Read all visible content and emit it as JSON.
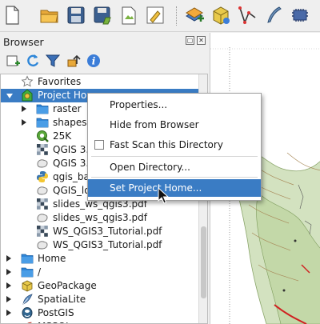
{
  "toolbar": {
    "icons": [
      "new-project-icon",
      "open-project-icon",
      "save-project-icon",
      "save-as-icon",
      "print-layout-icon",
      "style-manager-icon",
      "add-layer-icon",
      "new-geopackage-icon",
      "digitize-icon",
      "pen-icon",
      "processing-icon"
    ]
  },
  "browser": {
    "title": "Browser",
    "float_glyph": "▢",
    "close_glyph": "✕",
    "tools": [
      "add-selected-layers-icon",
      "refresh-icon",
      "filter-icon",
      "collapse-all-icon",
      "info-icon"
    ],
    "items": [
      {
        "label": "Favorites",
        "icon": "star-icon",
        "level": 0,
        "expander": "none"
      },
      {
        "label": "Project Home",
        "icon": "project-home-icon",
        "level": 0,
        "expander": "down",
        "selected": true
      },
      {
        "label": "raster",
        "icon": "folder-icon",
        "level": 1,
        "expander": "right"
      },
      {
        "label": "shapes",
        "icon": "folder-icon",
        "level": 1,
        "expander": "right"
      },
      {
        "label": "25K",
        "icon": "qgis-project-icon",
        "level": 1,
        "expander": "none"
      },
      {
        "label": "QGIS 3.",
        "icon": "raster-file-icon",
        "level": 1,
        "expander": "none"
      },
      {
        "label": "QGIS 3.",
        "icon": "vector-file-icon",
        "level": 1,
        "expander": "none"
      },
      {
        "label": "qgis_ba",
        "icon": "python-file-icon",
        "level": 1,
        "expander": "none"
      },
      {
        "label": "QGIS_lo",
        "icon": "vector-file-icon",
        "level": 1,
        "expander": "none"
      },
      {
        "label": "slides_ws_qgis3.pdf",
        "icon": "raster-file-icon",
        "level": 1,
        "expander": "none"
      },
      {
        "label": "slides_ws_qgis3.pdf",
        "icon": "vector-file-icon",
        "level": 1,
        "expander": "none"
      },
      {
        "label": "WS_QGIS3_Tutorial.pdf",
        "icon": "raster-file-icon",
        "level": 1,
        "expander": "none"
      },
      {
        "label": "WS_QGIS3_Tutorial.pdf",
        "icon": "vector-file-icon",
        "level": 1,
        "expander": "none"
      },
      {
        "label": "Home",
        "icon": "folder-icon",
        "level": 0,
        "expander": "right"
      },
      {
        "label": "/",
        "icon": "folder-icon",
        "level": 0,
        "expander": "right"
      },
      {
        "label": "GeoPackage",
        "icon": "geopackage-icon",
        "level": 0,
        "expander": "right"
      },
      {
        "label": "SpatiaLite",
        "icon": "spatialite-icon",
        "level": 0,
        "expander": "right"
      },
      {
        "label": "PostGIS",
        "icon": "postgis-icon",
        "level": 0,
        "expander": "right"
      },
      {
        "label": "MSSQL",
        "icon": "mssql-icon",
        "level": 0,
        "expander": "right"
      }
    ]
  },
  "context_menu": {
    "items": [
      {
        "label": "Properties...",
        "type": "item"
      },
      {
        "label": "Hide from Browser",
        "type": "item"
      },
      {
        "label": "Fast Scan this Directory",
        "type": "checkbox",
        "checked": false
      },
      {
        "label": "Open Directory...",
        "type": "item"
      },
      {
        "label": "Set Project Home...",
        "type": "item",
        "highlighted": true
      }
    ]
  },
  "colors": {
    "selection": "#3a7cc4",
    "folder": "#2e86d8",
    "panel": "#efefef"
  }
}
